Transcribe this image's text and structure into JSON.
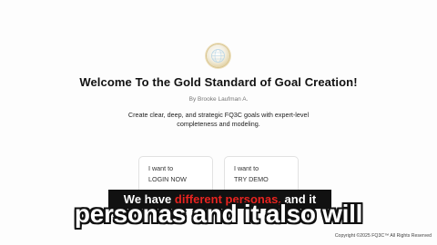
{
  "logo": {
    "icon": "gold-globe-logo-icon"
  },
  "header": {
    "title": "Welcome To the Gold Standard of Goal Creation!",
    "byline": "By Brooke Laufman A."
  },
  "description": {
    "line1": "Create clear, deep, and strategic FQ3C goals with expert-level",
    "line2": "completeness and modeling."
  },
  "cards": [
    {
      "prefix": "I want to",
      "action": "LOGIN NOW"
    },
    {
      "prefix": "I want to",
      "action": "TRY DEMO"
    }
  ],
  "caption": {
    "before": "We have ",
    "highlight": "different personas,",
    "after": " and it"
  },
  "big_caption": "personas and it also will",
  "footer": {
    "copyright": "Copyright ©2025 FQ3C™ All Rights Reserved"
  },
  "colors": {
    "caption_highlight": "#e8231f",
    "logo_gold": "#c9a85a"
  }
}
